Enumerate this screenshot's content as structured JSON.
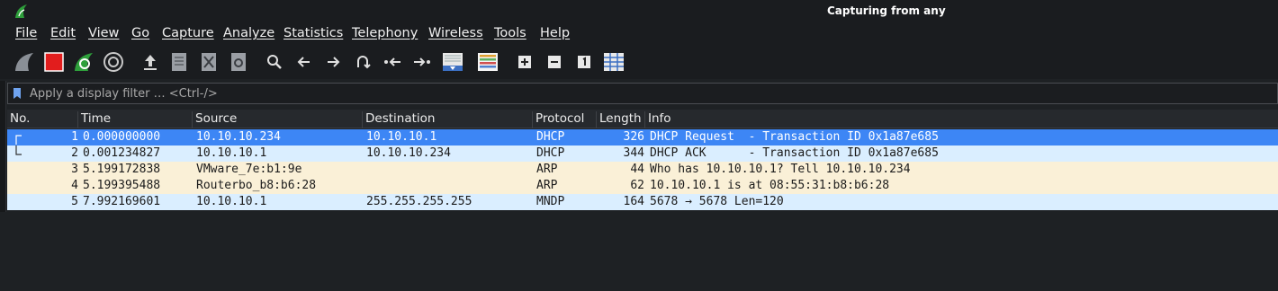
{
  "window": {
    "title": "Capturing from any"
  },
  "menu": [
    "File",
    "Edit",
    "View",
    "Go",
    "Capture",
    "Analyze",
    "Statistics",
    "Telephony",
    "Wireless",
    "Tools",
    "Help"
  ],
  "toolbar": {
    "icons": [
      "start-capture-icon",
      "stop-capture-icon",
      "restart-capture-icon",
      "capture-options-icon",
      "open-file-icon",
      "save-file-icon",
      "close-file-icon",
      "reload-file-icon",
      "find-packet-icon",
      "go-back-icon",
      "go-forward-icon",
      "go-to-packet-icon",
      "first-packet-icon",
      "last-packet-icon",
      "auto-scroll-icon",
      "colorize-icon",
      "zoom-in-icon",
      "zoom-out-icon",
      "normal-size-icon",
      "resize-columns-icon"
    ]
  },
  "filter": {
    "placeholder": "Apply a display filter … <Ctrl-/>"
  },
  "columns": [
    "No.",
    "Time",
    "Source",
    "Destination",
    "Protocol",
    "Length",
    "Info"
  ],
  "packets": [
    {
      "no": "1",
      "time": "0.000000000",
      "source": "10.10.10.234",
      "destination": "10.10.10.1",
      "protocol": "DHCP",
      "length": "326",
      "info": "DHCP Request  - Transaction ID 0x1a87e685",
      "bg": "#3d86f5",
      "selected": true
    },
    {
      "no": "2",
      "time": "0.001234827",
      "source": "10.10.10.1",
      "destination": "10.10.10.234",
      "protocol": "DHCP",
      "length": "344",
      "info": "DHCP ACK      - Transaction ID 0x1a87e685",
      "bg": "#daeeff",
      "selected": false
    },
    {
      "no": "3",
      "time": "5.199172838",
      "source": "VMware_7e:b1:9e",
      "destination": "",
      "protocol": "ARP",
      "length": "44",
      "info": "Who has 10.10.10.1? Tell 10.10.10.234",
      "bg": "#faf0d7",
      "selected": false
    },
    {
      "no": "4",
      "time": "5.199395488",
      "source": "Routerbo_b8:b6:28",
      "destination": "",
      "protocol": "ARP",
      "length": "62",
      "info": "10.10.10.1 is at 08:55:31:b8:b6:28",
      "bg": "#faf0d7",
      "selected": false
    },
    {
      "no": "5",
      "time": "7.992169601",
      "source": "10.10.10.1",
      "destination": "255.255.255.255",
      "protocol": "MNDP",
      "length": "164",
      "info": "5678 → 5678 Len=120",
      "bg": "#daeeff",
      "selected": false
    }
  ]
}
